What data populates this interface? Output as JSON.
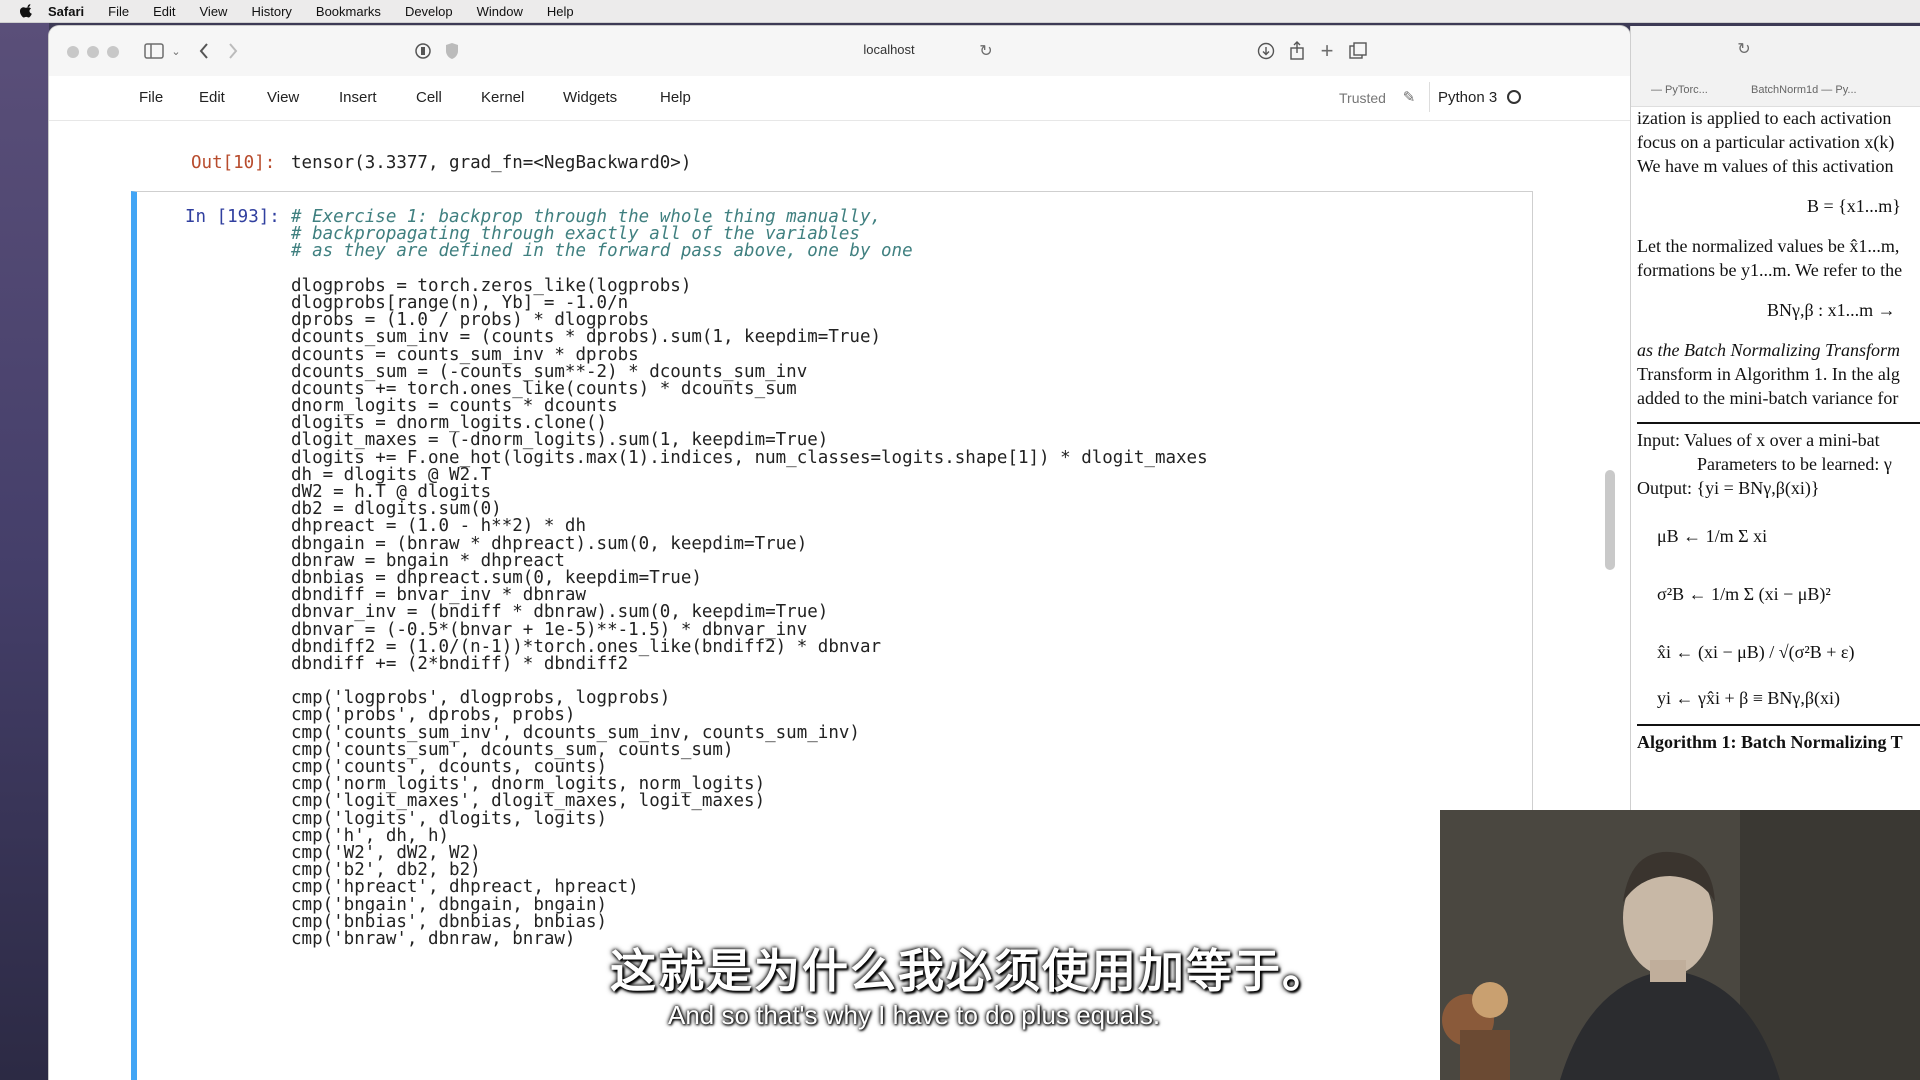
{
  "menubar": {
    "app": "Safari",
    "items": [
      "File",
      "Edit",
      "View",
      "History",
      "Bookmarks",
      "Develop",
      "Window",
      "Help"
    ]
  },
  "browser": {
    "address": "localhost"
  },
  "jupyter": {
    "menu": [
      "File",
      "Edit",
      "View",
      "Insert",
      "Cell",
      "Kernel",
      "Widgets",
      "Help"
    ],
    "trusted": "Trusted",
    "kernel": "Python 3"
  },
  "notebook": {
    "out_prompt": "Out[10]:",
    "out_text": "tensor(3.3377, grad_fn=<NegBackward0>)",
    "in_prompt": "In [193]:",
    "code_lines": [
      {
        "t": "# Exercise 1: backprop through the whole thing manually,",
        "c": "cm"
      },
      {
        "t": "# backpropagating through exactly all of the variables",
        "c": "cm"
      },
      {
        "t": "# as they are defined in the forward pass above, one by one",
        "c": "cm"
      },
      {
        "t": "",
        "c": ""
      },
      {
        "t": "dlogprobs = torch.zeros_like(logprobs)",
        "c": ""
      },
      {
        "t": "dlogprobs[range(n), Yb] = -1.0/n",
        "c": ""
      },
      {
        "t": "dprobs = (1.0 / probs) * dlogprobs",
        "c": ""
      },
      {
        "t": "dcounts_sum_inv = (counts * dprobs).sum(1, keepdim=True)",
        "c": ""
      },
      {
        "t": "dcounts = counts_sum_inv * dprobs",
        "c": ""
      },
      {
        "t": "dcounts_sum = (-counts_sum**-2) * dcounts_sum_inv",
        "c": ""
      },
      {
        "t": "dcounts += torch.ones_like(counts) * dcounts_sum",
        "c": ""
      },
      {
        "t": "dnorm_logits = counts * dcounts",
        "c": ""
      },
      {
        "t": "dlogits = dnorm_logits.clone()",
        "c": ""
      },
      {
        "t": "dlogit_maxes = (-dnorm_logits).sum(1, keepdim=True)",
        "c": ""
      },
      {
        "t": "dlogits += F.one_hot(logits.max(1).indices, num_classes=logits.shape[1]) * dlogit_maxes",
        "c": ""
      },
      {
        "t": "dh = dlogits @ W2.T",
        "c": ""
      },
      {
        "t": "dW2 = h.T @ dlogits",
        "c": ""
      },
      {
        "t": "db2 = dlogits.sum(0)",
        "c": ""
      },
      {
        "t": "dhpreact = (1.0 - h**2) * dh",
        "c": ""
      },
      {
        "t": "dbngain = (bnraw * dhpreact).sum(0, keepdim=True)",
        "c": ""
      },
      {
        "t": "dbnraw = bngain * dhpreact",
        "c": ""
      },
      {
        "t": "dbnbias = dhpreact.sum(0, keepdim=True)",
        "c": ""
      },
      {
        "t": "dbndiff = bnvar_inv * dbnraw",
        "c": ""
      },
      {
        "t": "dbnvar_inv = (bndiff * dbnraw).sum(0, keepdim=True)",
        "c": ""
      },
      {
        "t": "dbnvar = (-0.5*(bnvar + 1e-5)**-1.5) * dbnvar_inv",
        "c": ""
      },
      {
        "t": "dbndiff2 = (1.0/(n-1))*torch.ones_like(bndiff2) * dbnvar",
        "c": ""
      },
      {
        "t": "dbndiff += (2*bndiff) * dbndiff2",
        "c": ""
      },
      {
        "t": "",
        "c": ""
      },
      {
        "t": "cmp('logprobs', dlogprobs, logprobs)",
        "c": ""
      },
      {
        "t": "cmp('probs', dprobs, probs)",
        "c": ""
      },
      {
        "t": "cmp('counts_sum_inv', dcounts_sum_inv, counts_sum_inv)",
        "c": ""
      },
      {
        "t": "cmp('counts_sum', dcounts_sum, counts_sum)",
        "c": ""
      },
      {
        "t": "cmp('counts', dcounts, counts)",
        "c": ""
      },
      {
        "t": "cmp('norm_logits', dnorm_logits, norm_logits)",
        "c": ""
      },
      {
        "t": "cmp('logit_maxes', dlogit_maxes, logit_maxes)",
        "c": ""
      },
      {
        "t": "cmp('logits', dlogits, logits)",
        "c": ""
      },
      {
        "t": "cmp('h', dh, h)",
        "c": ""
      },
      {
        "t": "cmp('W2', dW2, W2)",
        "c": ""
      },
      {
        "t": "cmp('b2', db2, b2)",
        "c": ""
      },
      {
        "t": "cmp('hpreact', dhpreact, hpreact)",
        "c": ""
      },
      {
        "t": "cmp('bngain', dbngain, bngain)",
        "c": ""
      },
      {
        "t": "cmp('bnbias', dbnbias, bnbias)",
        "c": ""
      },
      {
        "t": "cmp('bnraw', dbnraw, bnraw)",
        "c": ""
      }
    ]
  },
  "pdf": {
    "tabs": [
      "— PyTorc...",
      "BatchNorm1d — Py..."
    ],
    "lines": [
      "ization is applied to each activation",
      "focus on a particular activation x(k)",
      "We have m values of this activation",
      "B = {x1...m}",
      "Let the normalized values be x̂1...m,",
      "formations be y1...m. We refer to the",
      "BNγ,β : x1...m →",
      "as the Batch Normalizing Transform",
      "Transform in Algorithm 1. In the alg",
      "added to the mini-batch variance for",
      "Input: Values of x over a mini-bat",
      "Parameters to be learned: γ",
      "Output: {yi = BNγ,β(xi)}",
      "μB ← 1/m Σ xi",
      "σ²B ← 1/m Σ (xi − μB)²",
      "x̂i ← (xi − μB) / √(σ²B + ε)",
      "yi ← γx̂i + β ≡ BNγ,β(xi)",
      "Algorithm 1: Batch Normalizing T"
    ]
  },
  "subtitles": {
    "zh": "这就是为什么我必须使用加等于。",
    "en": "And so that's why I have to do plus equals."
  }
}
